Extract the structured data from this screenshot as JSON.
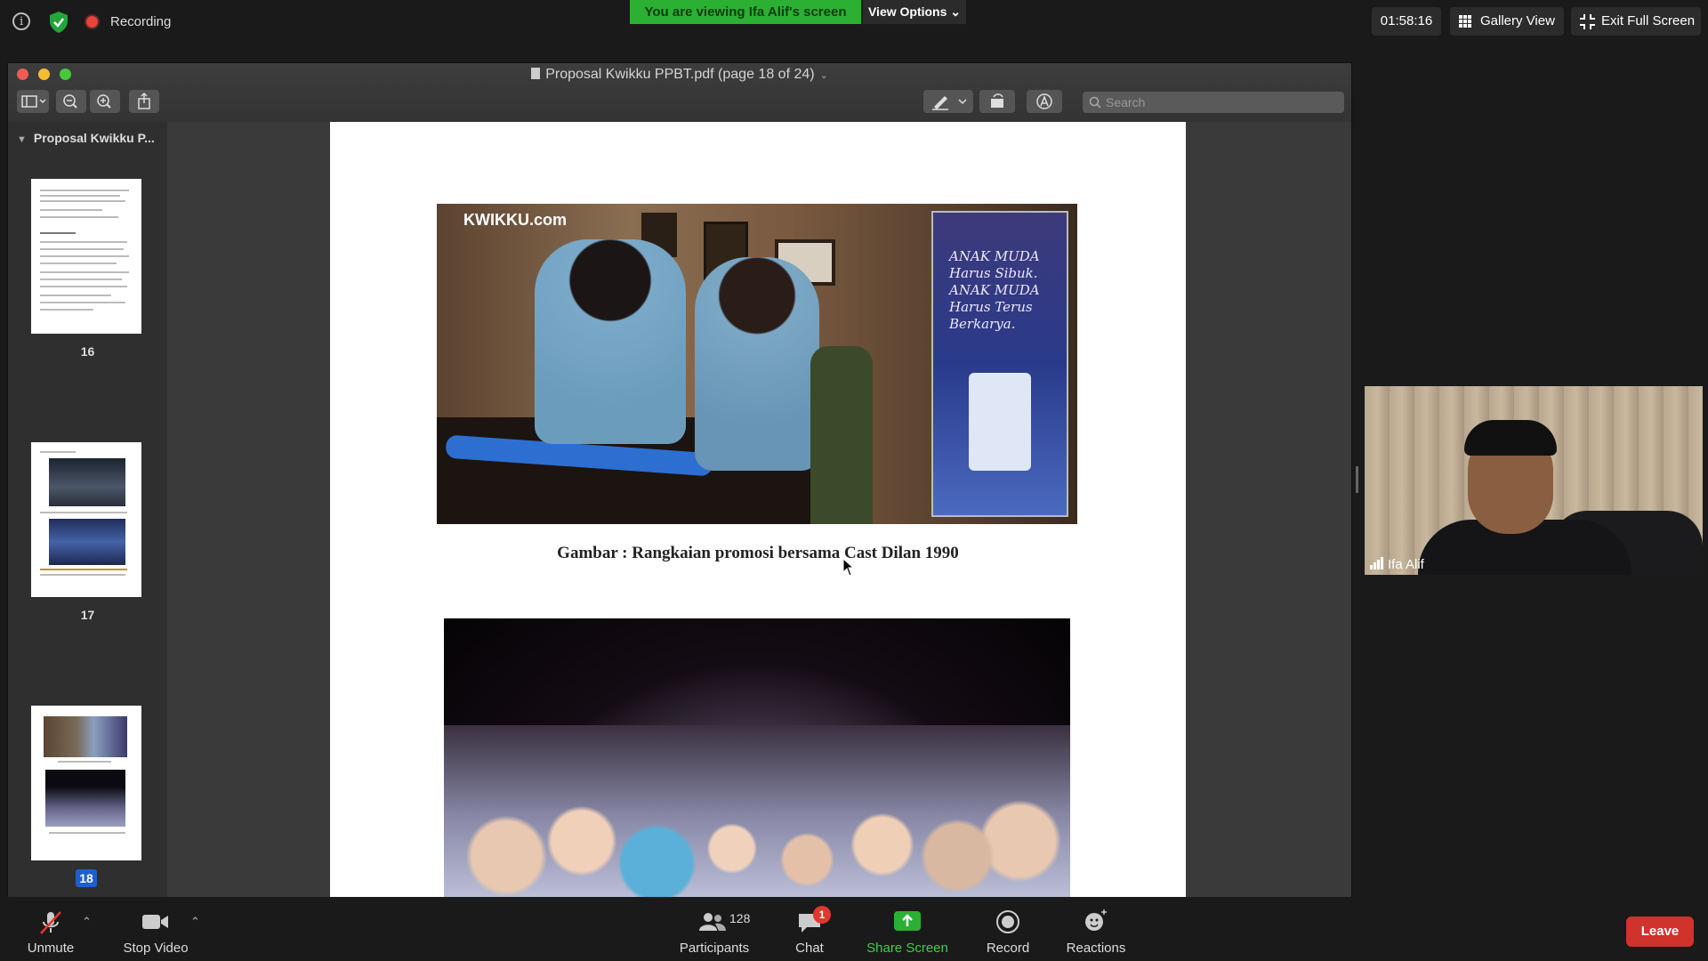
{
  "topbar": {
    "recording_label": "Recording",
    "viewing_banner": "You are viewing Ifa Alif's screen",
    "view_options": "View Options ⌄",
    "timer": "01:58:16",
    "gallery_view": "Gallery View",
    "exit_fullscreen": "Exit Full Screen"
  },
  "pdf_window": {
    "title": "Proposal Kwikku PPBT.pdf (page 18 of 24)",
    "search_placeholder": "Search",
    "sidebar_title": "Proposal Kwikku P...",
    "pages": [
      {
        "number": "16"
      },
      {
        "number": "17"
      },
      {
        "number": "18",
        "selected": true
      }
    ],
    "page": {
      "caption": "Gambar : Rangkaian promosi bersama Cast Dilan 1990",
      "photo1_logo": "KWIKKU.com",
      "photo1_banner_text": "ANAK MUDA Harus Sibuk. ANAK MUDA Harus Terus Berkarya."
    }
  },
  "video": {
    "participant_name": "Ifa Alif"
  },
  "bottombar": {
    "unmute": "Unmute",
    "stop_video": "Stop Video",
    "participants": "Participants",
    "participants_count": "128",
    "chat": "Chat",
    "chat_badge": "1",
    "share_screen": "Share Screen",
    "record": "Record",
    "reactions": "Reactions",
    "leave": "Leave"
  },
  "colors": {
    "share_green": "#2bb033",
    "leave_red": "#d0322c",
    "badge_red": "#e0372f",
    "selected_blue": "#1e5fd0"
  }
}
